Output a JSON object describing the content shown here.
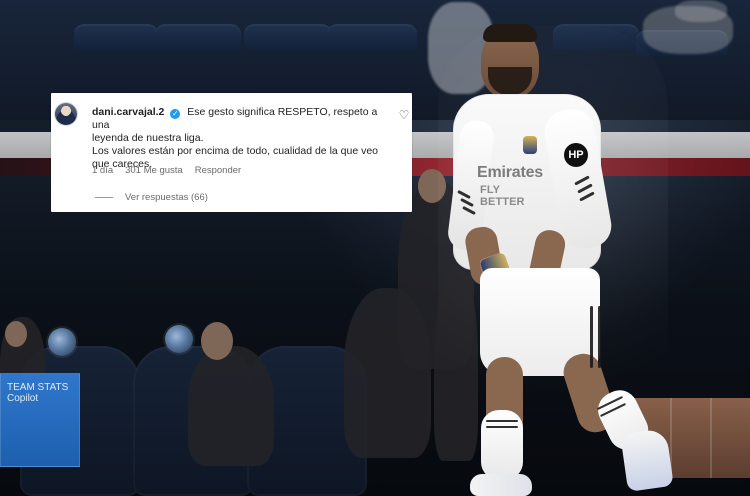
{
  "comment": {
    "username": "dani.carvajal.2",
    "text_line_1": "Ese gesto significa RESPETO, respeto a una",
    "text_line_2": "leyenda de nuestra liga.",
    "text_line_3": "Los valores están por encima de todo, cualidad de la que veo",
    "text_line_4": "que careces.",
    "age": "1 día",
    "likes": "301 Me gusta",
    "reply": "Responder",
    "view_replies": "Ver respuestas (66)"
  },
  "sign": {
    "line_1": "TEAM STATS",
    "line_2": "Copilot"
  },
  "jersey": {
    "sponsor_line_1": "Emirates",
    "sponsor_line_2": "FLY BETTER",
    "mini_logo": "HP"
  },
  "icons": {
    "verified": "verified-badge-icon",
    "like": "heart-icon"
  },
  "colors": {
    "card_background": "#ffffff",
    "verified_blue": "#1d9bf0"
  }
}
